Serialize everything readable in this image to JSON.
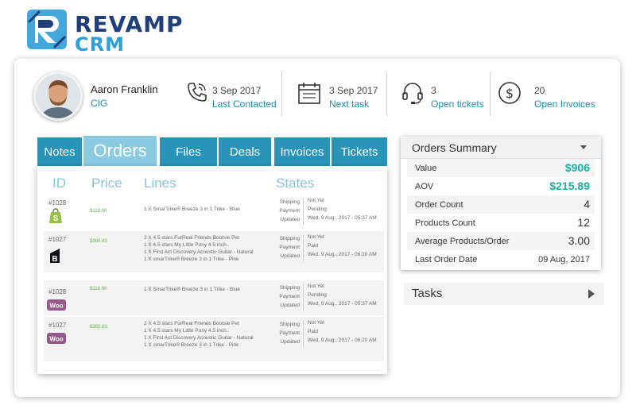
{
  "brand": {
    "name": "REVAMP",
    "product": "CRM"
  },
  "contact": {
    "name": "Aaron Franklin",
    "company": "CIG"
  },
  "stats": [
    {
      "value": "3 Sep 2017",
      "label": "Last Contacted",
      "icon": "phone-icon"
    },
    {
      "value": "3 Sep 2017",
      "label": "Next task",
      "icon": "calendar-icon"
    },
    {
      "value": "3",
      "label": "Open tickets",
      "icon": "headset-icon"
    },
    {
      "value": "20",
      "label": "Open Invoices",
      "icon": "dollar-icon"
    }
  ],
  "tabs": [
    {
      "label": "Notes",
      "active": false
    },
    {
      "label": "Orders",
      "active": true
    },
    {
      "label": "Files",
      "active": false
    },
    {
      "label": "Deals",
      "active": false
    },
    {
      "label": "Invoices",
      "active": false
    },
    {
      "label": "Tickets",
      "active": false
    }
  ],
  "orders_table": {
    "headers": {
      "id": "ID",
      "price": "Price",
      "lines": "Lines",
      "states": "States"
    },
    "state_keys": {
      "shipping": "Shipping",
      "payment": "Payment",
      "updated": "Updated"
    },
    "orders": [
      {
        "id": "#1028",
        "price": "$118.00",
        "platform": "shopify",
        "lines": [
          "1 X SmarTrike® Breeze 3 in 1 Trike - Blue"
        ],
        "shipping": "Not Yet",
        "payment": "Pending",
        "updated": "Wed, 9 Aug., 2017 - 05:37 AM"
      },
      {
        "id": "#1027",
        "price": "$380.83",
        "platform": "bigcommerce",
        "lines": [
          "2 X 4.5 stars FurReal Friends Bootsie Pet",
          "1 X 4.5 stars My Little Pony 4.5 inch..",
          "1 X First Act Discovery Acoustic Guitar - Natural",
          "1 X smarTrike® Breeze 3 in 1 Trike - Pink"
        ],
        "shipping": "Not Yet",
        "payment": "Paid",
        "updated": "Wed, 9 Aug., 2017 - 06:20 AM"
      },
      {
        "id": "#1028",
        "price": "$118.00",
        "platform": "woocommerce",
        "lines": [
          "1 X SmarTrike® Breeze 3 in 1 Trike - Blue"
        ],
        "shipping": "Not Yet",
        "payment": "Pending",
        "updated": "Wed, 9 Aug., 2017 - 05:37 AM"
      },
      {
        "id": "#1027",
        "price": "$380.83",
        "platform": "woocommerce",
        "lines": [
          "2 X 4.5 stars FurReal Friends Bootsie Pet",
          "1 X 4.5 stars My Little Pony 4.5 inch..",
          "1 X First Act Discovery Acoustic Guitar - Natural",
          "1 X smarTrike® Breeze 3 in 1 Trike - Pink"
        ],
        "shipping": "Not Yet",
        "payment": "Paid",
        "updated": "Wed, 9 Aug., 2017 - 06:20 AM"
      }
    ]
  },
  "orders_summary": {
    "title": "Orders Summary",
    "rows": [
      {
        "label": "Value",
        "value": "$906"
      },
      {
        "label": "AOV",
        "value": "$215.89"
      },
      {
        "label": "Order Count",
        "value": "4"
      },
      {
        "label": "Products Count",
        "value": "12"
      },
      {
        "label": "Average Products/Order",
        "value": "3.00"
      },
      {
        "label": "Last Order Date",
        "value": "09 Aug, 2017"
      }
    ]
  },
  "tasks": {
    "title": "Tasks"
  },
  "colors": {
    "accent": "#2a94b8",
    "active_tab": "#8bcbe2",
    "link": "#1a8fb5",
    "money": "#19b0a0",
    "price": "#6ab04c",
    "brand_dark": "#1f3f7a",
    "brand_light": "#2d9fd8"
  }
}
